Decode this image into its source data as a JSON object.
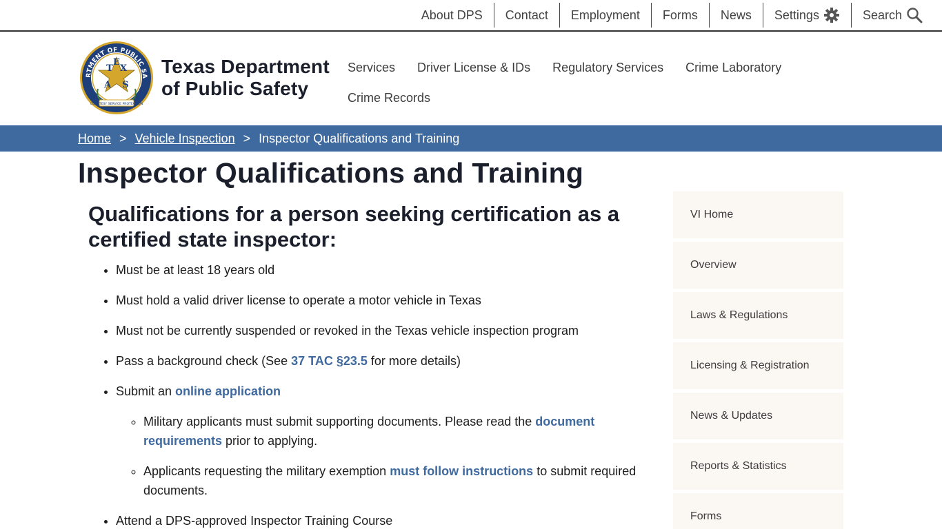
{
  "utility_nav": {
    "about": "About DPS",
    "contact": "Contact",
    "employment": "Employment",
    "forms": "Forms",
    "news": "News",
    "settings": "Settings",
    "search": "Search"
  },
  "brand": {
    "line1": "Texas Department",
    "line2": "of Public Safety",
    "seal_text": "DEPARTMENT OF PUBLIC SAFETY",
    "seal_letters": [
      "T",
      "E",
      "X",
      "A",
      "S"
    ],
    "seal_motto": "COURTESY SERVICE PROTECTION"
  },
  "main_nav": [
    {
      "label": "Services"
    },
    {
      "label": "Driver License & IDs"
    },
    {
      "label": "Regulatory Services"
    },
    {
      "label": "Crime Laboratory"
    },
    {
      "label": "Crime Records"
    }
  ],
  "breadcrumb": {
    "home": "Home",
    "section": "Vehicle Inspection",
    "separator": ">",
    "current": "Inspector Qualifications and Training"
  },
  "page_title": "Inspector Qualifications and Training",
  "content": {
    "heading": "Qualifications for a person seeking certification as a certified state inspector:",
    "items": {
      "age": "Must be at least 18 years old",
      "license": "Must hold a valid driver license to operate a motor vehicle in Texas",
      "suspended": "Must not be currently suspended or revoked in the Texas vehicle inspection program",
      "background_pre": "Pass a background check (See ",
      "background_link": "37 TAC §23.5",
      "background_post": " for more details)",
      "submit_pre": "Submit an ",
      "submit_link": "online application",
      "military_pre": "Military applicants must submit supporting documents. Please read the ",
      "military_link": "document requirements",
      "military_post": " prior to applying.",
      "exemption_pre": "Applicants requesting the military exemption ",
      "exemption_link": "must follow instructions",
      "exemption_post": " to submit required documents.",
      "training": "Attend a DPS-approved Inspector Training Course"
    }
  },
  "sidebar": [
    {
      "label": "VI Home"
    },
    {
      "label": "Overview"
    },
    {
      "label": "Laws & Regulations"
    },
    {
      "label": "Licensing & Registration"
    },
    {
      "label": "News & Updates"
    },
    {
      "label": "Reports & Statistics"
    },
    {
      "label": "Forms"
    }
  ],
  "colors": {
    "primary_blue": "#3f6aa0",
    "breadcrumb_bg": "#3f6aa0",
    "sidebar_bg": "#fbf7f3",
    "heading_text": "#1a1f2b",
    "seal_gold": "#d4a72c",
    "seal_blue": "#1f3f7a"
  },
  "icons": {
    "settings": "gear-icon",
    "search": "search-icon"
  }
}
